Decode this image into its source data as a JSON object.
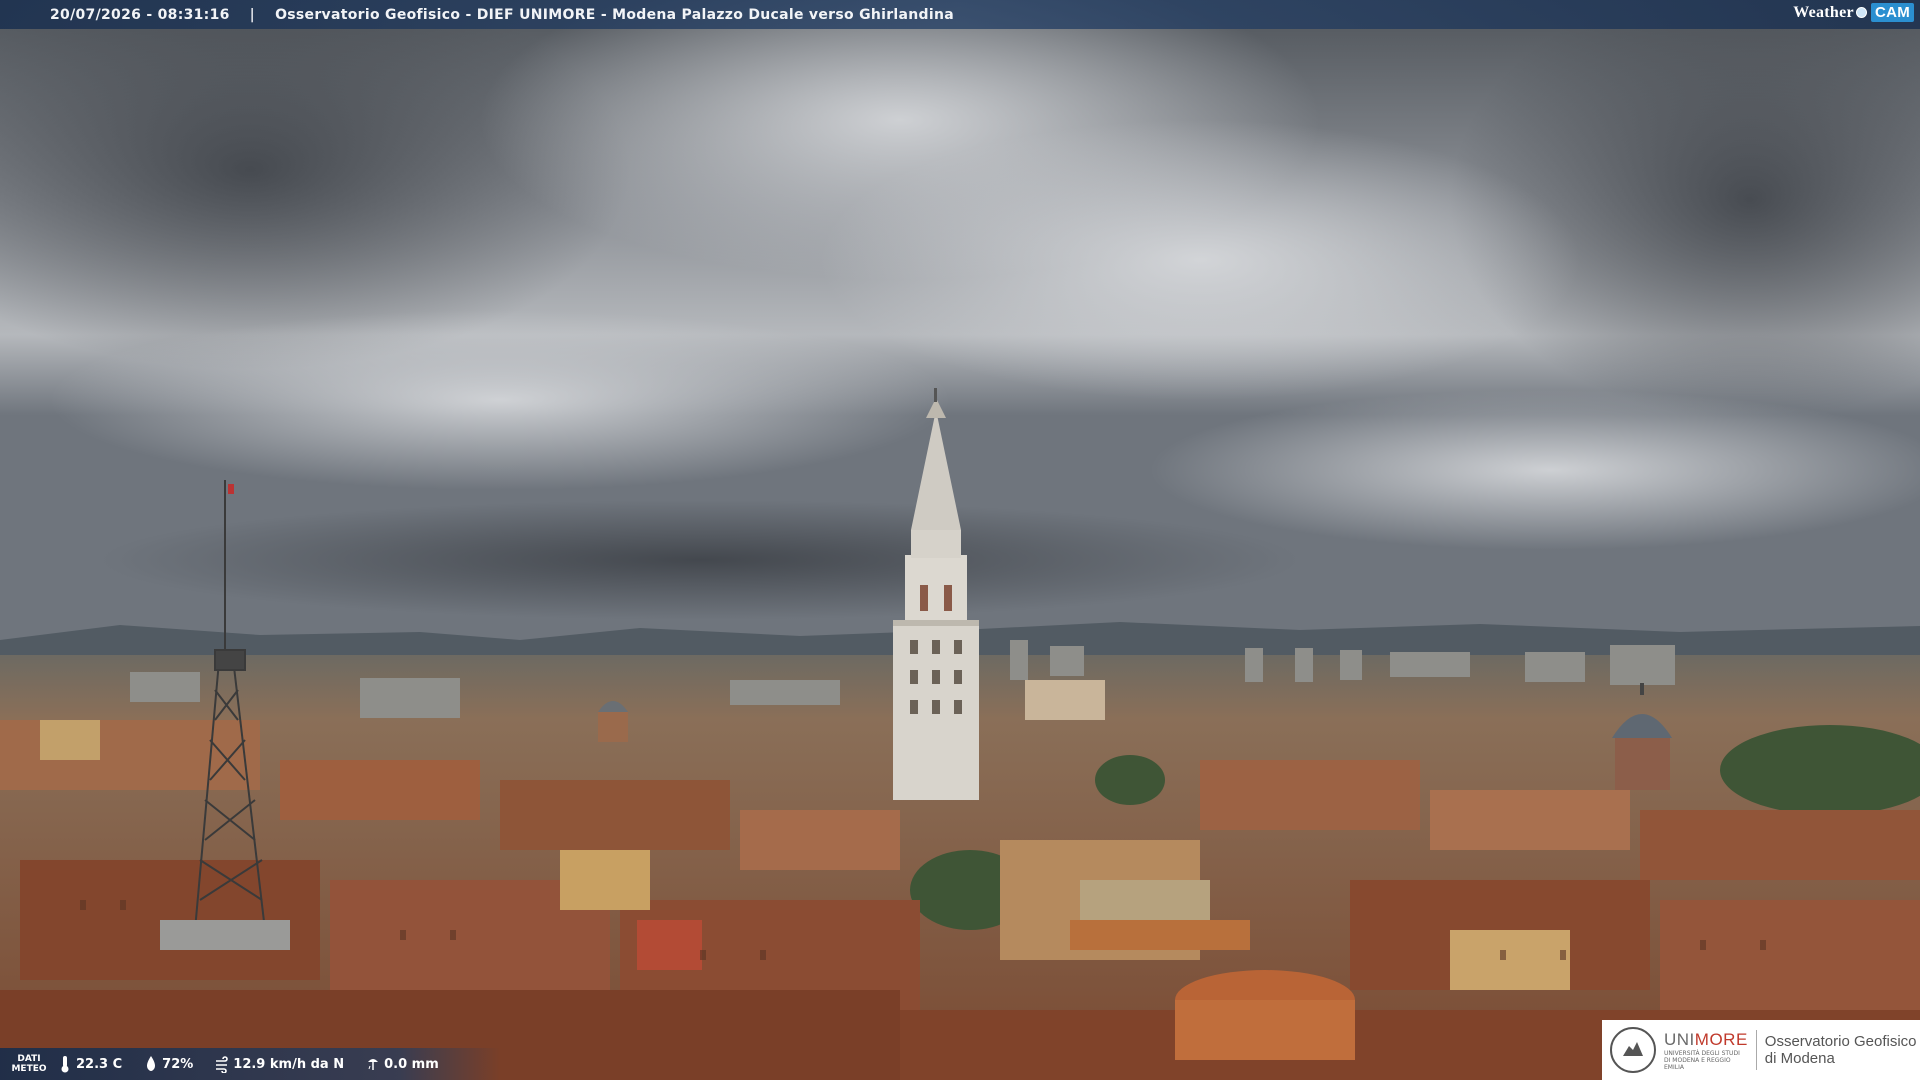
{
  "header": {
    "timestamp": "20/07/2026 - 08:31:16",
    "separator": "|",
    "location_title": "Osservatorio Geofisico - DIEF UNIMORE - Modena Palazzo Ducale verso Ghirlandina",
    "brand_weather": "Weather",
    "brand_cam": "CAM"
  },
  "meteo": {
    "label_line1": "DATI",
    "label_line2": "METEO",
    "temperature": "22.3 C",
    "humidity": "72%",
    "wind": "12.9 km/h da N",
    "rain": "0.0 mm"
  },
  "logo": {
    "uni_part1": "UNI",
    "uni_part2": "MORE",
    "uni_subtitle": "UNIVERSITÀ DEGLI STUDI DI MODENA E REGGIO EMILIA",
    "observatory_line1": "Osservatorio Geofisico",
    "observatory_line2": "di Modena"
  },
  "colors": {
    "sky_dark": "#5d6268",
    "sky_light": "#c9ccd0",
    "roof": "#9a5c3e",
    "tower": "#d9d6d0",
    "overlay_blue": "#1e3250",
    "accent_red": "#c0392b",
    "accent_blue": "#2b8fd0"
  },
  "icons": {
    "temperature": "thermometer-icon",
    "humidity": "droplet-icon",
    "wind": "wind-icon",
    "rain": "rain-gauge-icon"
  }
}
